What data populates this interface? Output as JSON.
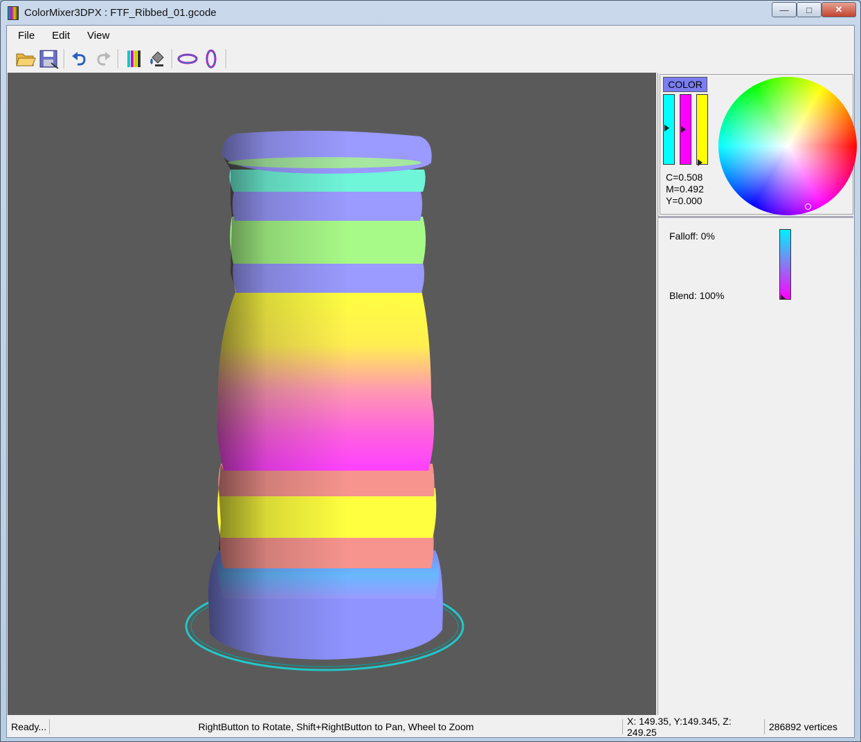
{
  "window": {
    "title": "ColorMixer3DPX : FTF_Ribbed_01.gcode",
    "minimize_glyph": "—",
    "maximize_glyph": "□",
    "close_glyph": "✕"
  },
  "menu": {
    "items": [
      {
        "label": "File"
      },
      {
        "label": "Edit"
      },
      {
        "label": "View"
      }
    ]
  },
  "toolbar": {
    "buttons": [
      "open-icon",
      "save-icon",
      "undo-icon",
      "redo-icon",
      "color-bars-icon",
      "paint-bucket-icon",
      "horizontal-ring-icon",
      "vertical-ring-icon"
    ]
  },
  "color_panel": {
    "label": "COLOR",
    "channels": [
      {
        "name": "C",
        "color": "#00ffff",
        "level": 0.508
      },
      {
        "name": "M",
        "color": "#ff00ff",
        "level": 0.492
      },
      {
        "name": "Y",
        "color": "#ffff00",
        "level": 0.0
      }
    ],
    "c_text": "C=0.508",
    "m_text": "M=0.492",
    "y_text": "Y=0.000"
  },
  "brush_panel": {
    "falloff": "Falloff: 0%",
    "blend": "Blend: 100%"
  },
  "status": {
    "state": "Ready...",
    "hint": "RightButton to Rotate, Shift+RightButton to Pan, Wheel to Zoom",
    "coords": "X: 149.35, Y:149.345, Z: 249.25",
    "vertices": "286892 vertices"
  },
  "colors": {
    "viewport_bg": "#5a5a5a",
    "accent": "#7b7ef0"
  }
}
